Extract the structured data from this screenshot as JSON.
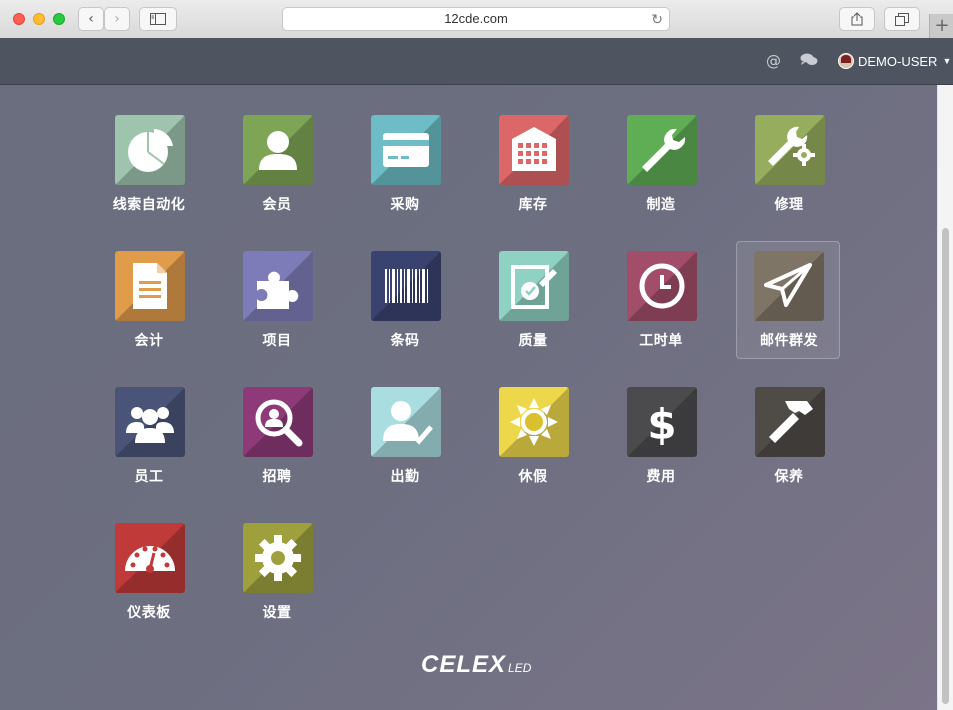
{
  "browser": {
    "url": "12cde.com"
  },
  "appbar": {
    "mention_icon": "at-icon",
    "chat_icon": "chat-icon",
    "user_name": "DEMO-USER"
  },
  "apps": [
    {
      "label": "线索自动化",
      "icon": "pie-chart-icon",
      "color": "#9fc4ad"
    },
    {
      "label": "会员",
      "icon": "user-icon",
      "color": "#7ea555"
    },
    {
      "label": "采购",
      "icon": "credit-card-icon",
      "color": "#6dbcc6"
    },
    {
      "label": "库存",
      "icon": "warehouse-icon",
      "color": "#dc6768"
    },
    {
      "label": "制造",
      "icon": "wrench-icon",
      "color": "#5fad55"
    },
    {
      "label": "修理",
      "icon": "wrench-gear-icon",
      "color": "#96ad5d"
    },
    {
      "label": "会计",
      "icon": "document-icon",
      "color": "#e09b4b"
    },
    {
      "label": "项目",
      "icon": "puzzle-icon",
      "color": "#7e7cb8"
    },
    {
      "label": "条码",
      "icon": "barcode-icon",
      "color": "#3a4270"
    },
    {
      "label": "质量",
      "icon": "quality-check-icon",
      "color": "#8fd1c2"
    },
    {
      "label": "工时单",
      "icon": "clock-icon",
      "color": "#a24e6a"
    },
    {
      "label": "邮件群发",
      "icon": "paper-plane-icon",
      "color": "#7f7566"
    },
    {
      "label": "员工",
      "icon": "users-icon",
      "color": "#4a5478"
    },
    {
      "label": "招聘",
      "icon": "search-user-icon",
      "color": "#8e3a78"
    },
    {
      "label": "出勤",
      "icon": "user-check-icon",
      "color": "#a9dde0"
    },
    {
      "label": "休假",
      "icon": "sun-icon",
      "color": "#ecd84a"
    },
    {
      "label": "费用",
      "icon": "dollar-icon",
      "color": "#4b4b4e"
    },
    {
      "label": "保养",
      "icon": "hammer-icon",
      "color": "#4f4b47"
    },
    {
      "label": "仪表板",
      "icon": "dashboard-icon",
      "color": "#c03a3a"
    },
    {
      "label": "设置",
      "icon": "gear-icon",
      "color": "#9ea03d"
    }
  ],
  "footer": {
    "logo_main": "CELEX",
    "logo_sub": "LED"
  }
}
